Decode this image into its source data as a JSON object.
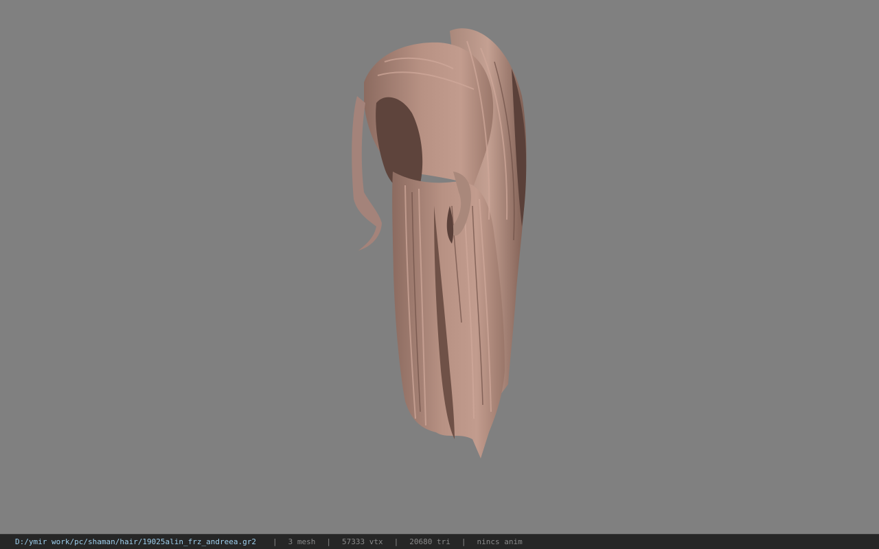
{
  "viewport": {
    "background": "#808080",
    "model": {
      "icon": "hair-mesh-icon",
      "base_color": "#b38d80",
      "shadow_color": "#5a4039",
      "highlight_color": "#cfa89a"
    }
  },
  "status_bar": {
    "file_path": "D:/ymir work/pc/shaman/hair/19025alin_frz_andreea.gr2",
    "separator": "|",
    "mesh_count": "3 mesh",
    "vertex_count": "57333 vtx",
    "triangle_count": "20680 tri",
    "anim_status": "nincs anim",
    "path_color": "#9fd0ee",
    "text_color": "#8a8a8a"
  }
}
